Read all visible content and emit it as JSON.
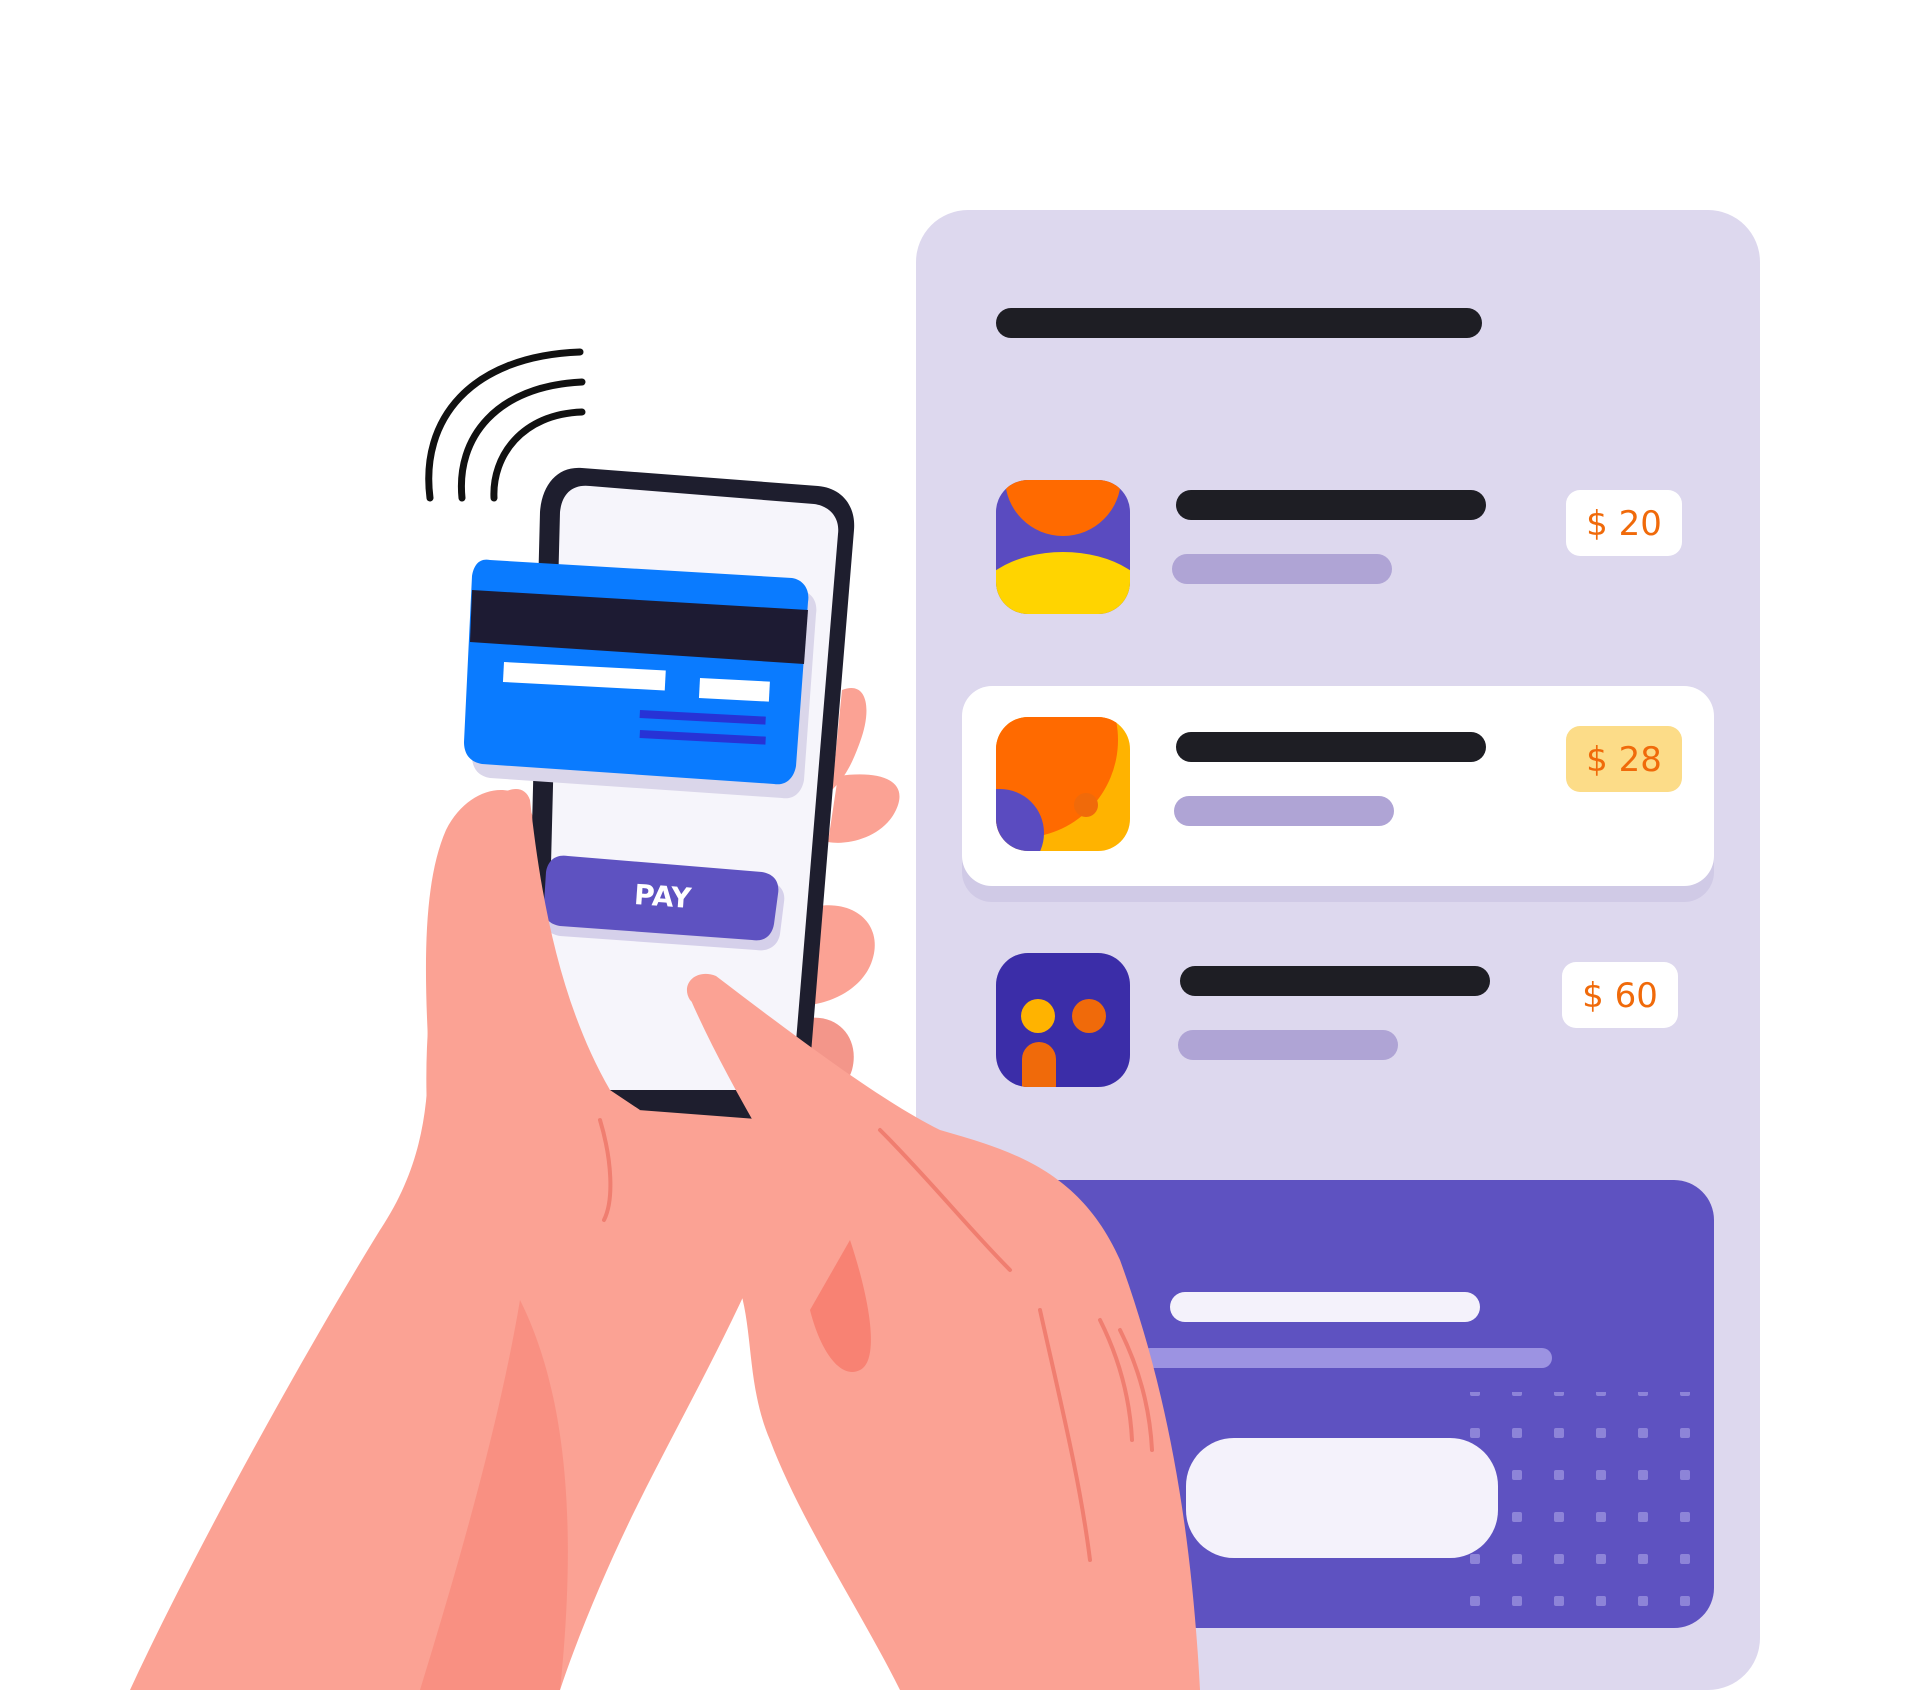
{
  "phone": {
    "pay_label": "PAY"
  },
  "list": {
    "items": [
      {
        "icon": "blob-app-icon",
        "price": "$ 20",
        "selected": false
      },
      {
        "icon": "circles-app-icon",
        "price": "$ 28",
        "selected": true
      },
      {
        "icon": "face-app-icon",
        "price": "$ 60",
        "selected": false
      }
    ]
  },
  "colors": {
    "panel": "#DDD8EE",
    "accent": "#5E52C1",
    "price_text": "#F06A0A",
    "selected_badge": "#FCDC88",
    "card_blue": "#0A7BFF",
    "skin": "#FBA294",
    "dark_line": "#1E1E24",
    "light_line": "#AFA4D5"
  }
}
